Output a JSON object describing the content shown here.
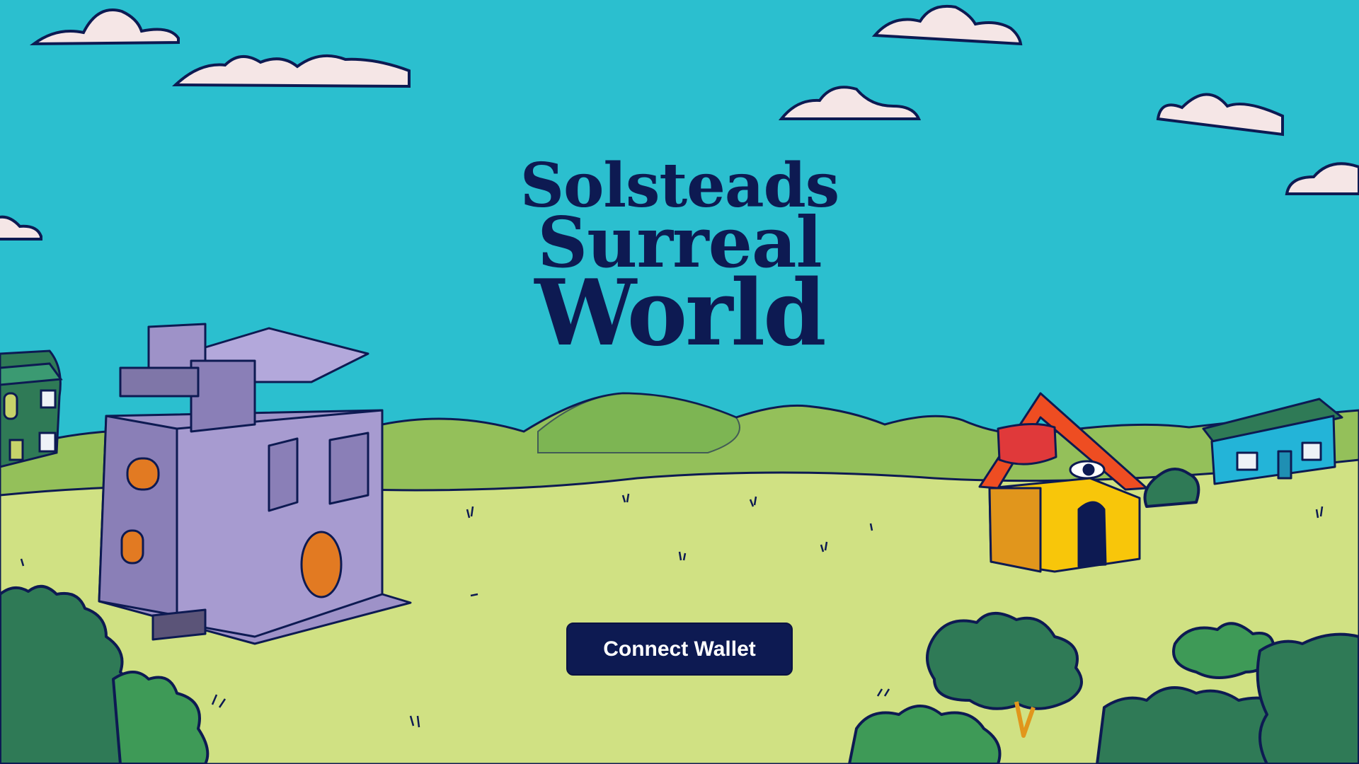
{
  "title": {
    "line1": "Solsteads",
    "line2": "Surreal",
    "line3": "World"
  },
  "connect_button": {
    "label": "Connect Wallet"
  },
  "colors": {
    "sky": "#2bbfcf",
    "hills": "#94c05a",
    "meadow": "#d0e183",
    "navy": "#0d1a52",
    "cloud": "#f5e6e6",
    "bush": "#2f7a56"
  }
}
